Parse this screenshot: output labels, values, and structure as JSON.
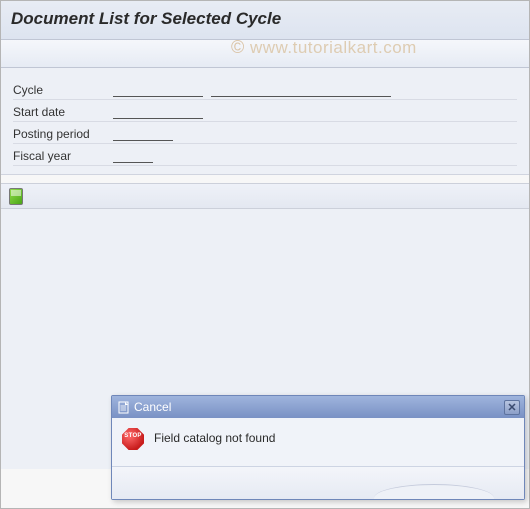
{
  "header": {
    "title": "Document List for Selected Cycle"
  },
  "watermark": "www.tutorialkart.com",
  "form": {
    "cycle": {
      "label": "Cycle",
      "value": "",
      "value2": ""
    },
    "start_date": {
      "label": "Start date",
      "value": ""
    },
    "posting_period": {
      "label": "Posting period",
      "value": ""
    },
    "fiscal_year": {
      "label": "Fiscal year",
      "value": ""
    }
  },
  "dialog": {
    "title": "Cancel",
    "message": "Field catalog not found",
    "stop_text": "STOP"
  }
}
